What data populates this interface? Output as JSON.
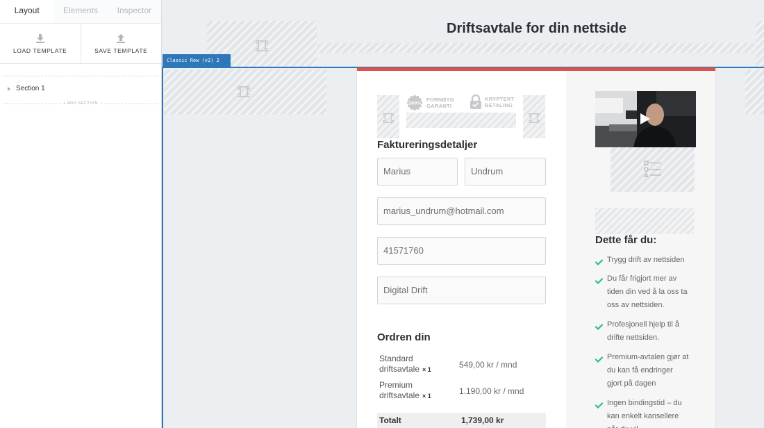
{
  "sidebar": {
    "tabs": [
      "Layout",
      "Elements",
      "Inspector"
    ],
    "load_template": "LOAD TEMPLATE",
    "save_template": "SAVE TEMPLATE",
    "tree": {
      "section_label": "Section 1"
    },
    "add_section": "+ ADD SECTION"
  },
  "canvas": {
    "page_title": "Driftsavtale for din nettside",
    "row_tag": "Classic Row (v2) 2"
  },
  "badges": {
    "guarantee": [
      "FORNØYD",
      "GARANTI"
    ],
    "guarantee_seal": "100%",
    "secure": [
      "KRYPTERT",
      "BETALING"
    ]
  },
  "billing": {
    "heading": "Faktureringsdetaljer",
    "first_name": "Marius",
    "last_name": "Undrum",
    "email": "marius_undrum@hotmail.com",
    "phone": "41571760",
    "company": "Digital Drift"
  },
  "order": {
    "heading": "Ordren din",
    "items": [
      {
        "name_line1": "Standard",
        "name_line2": "driftsavtale",
        "qty": "× 1",
        "price": "549,00 kr / mnd"
      },
      {
        "name_line1": "Premium",
        "name_line2": "driftsavtale",
        "qty": "× 1",
        "price": "1.190,00 kr / mnd"
      }
    ],
    "total_label": "Totalt",
    "total_value": "1,739,00 kr"
  },
  "benefits": {
    "heading": "Dette får du:",
    "items": [
      [
        "Trygg drift av nettsiden"
      ],
      [
        "Du får frigjort mer av",
        "tiden din ved å la oss ta",
        "oss av nettsiden."
      ],
      [
        "Profesjonell hjelp til å",
        "drifte nettsiden."
      ],
      [
        "Premium-avtalen gjør at",
        "du kan få endringer",
        "gjort på dagen"
      ],
      [
        "Ingen bindingstid – du",
        "kan enkelt kansellere",
        "når du vil"
      ]
    ]
  },
  "colors": {
    "accent_red": "#d9534f",
    "row_blue": "#2e77b8",
    "check_green": "#2ebd7e"
  }
}
